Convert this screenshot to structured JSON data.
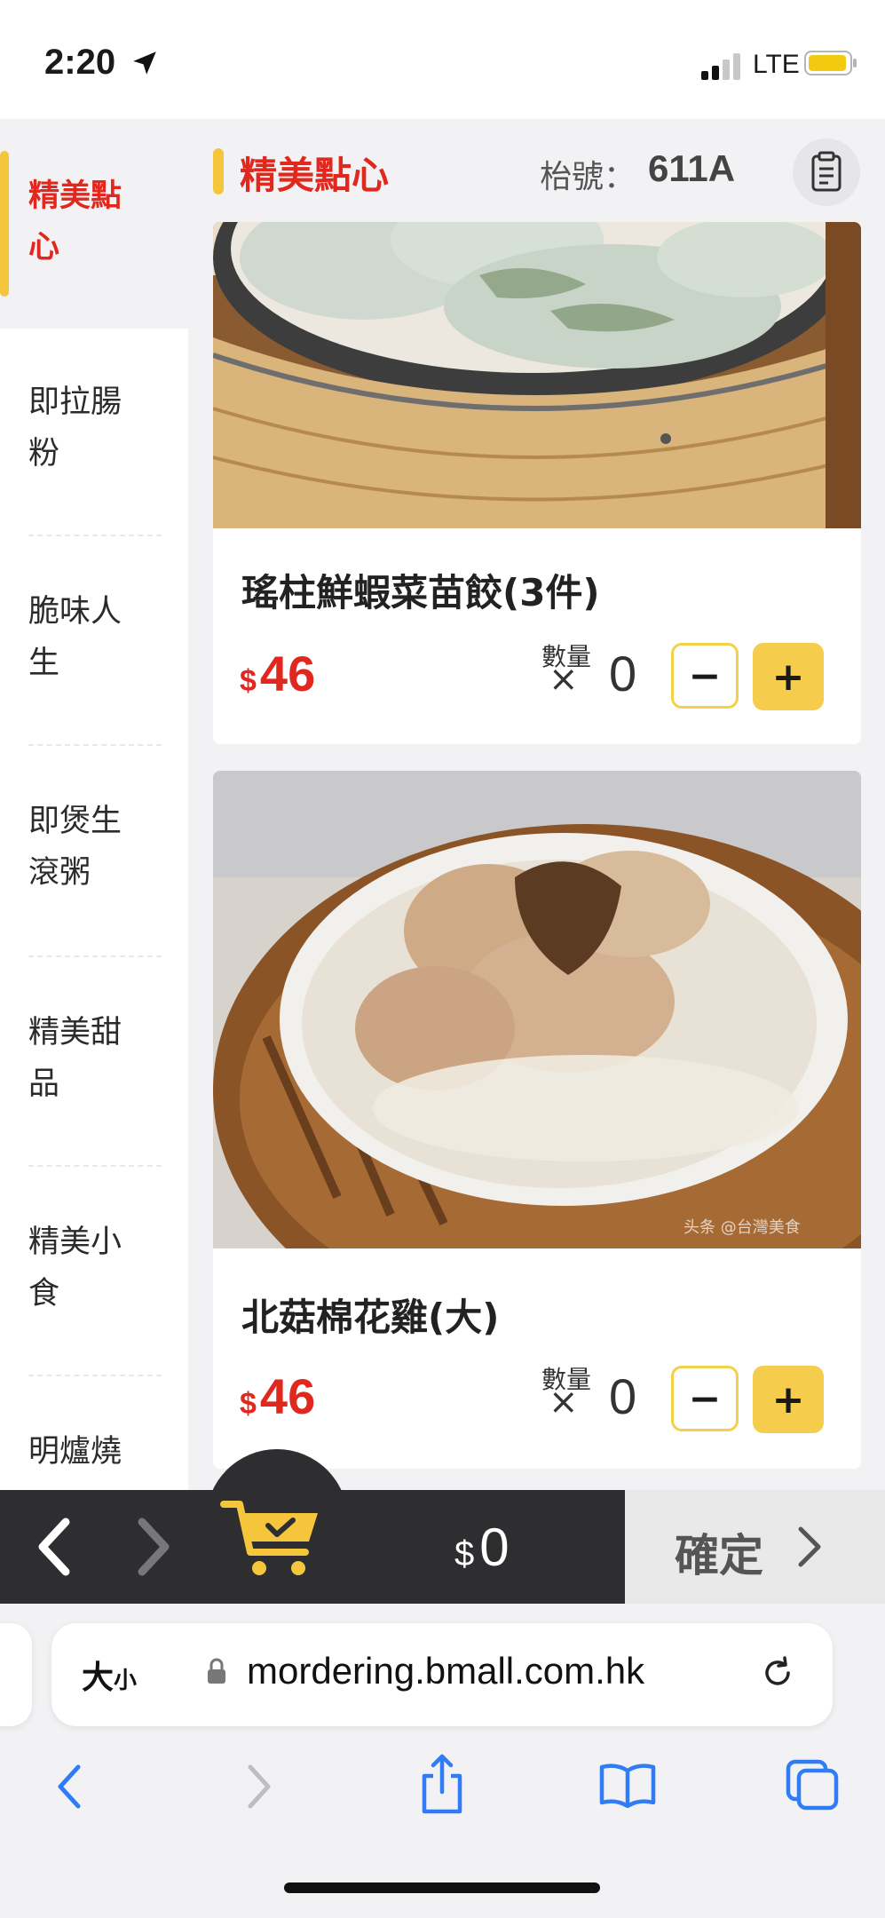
{
  "status_bar": {
    "time": "2:20",
    "network": "LTE"
  },
  "sidebar": {
    "items": [
      {
        "label": "精美點心"
      },
      {
        "label": "即拉腸粉"
      },
      {
        "label": "脆味人生"
      },
      {
        "label": "即煲生滾粥"
      },
      {
        "label": "精美甜品"
      },
      {
        "label": "精美小食"
      },
      {
        "label": "明爐燒"
      }
    ]
  },
  "header": {
    "title": "精美點心",
    "table_label": "枱號：",
    "table_number": "611A"
  },
  "products": [
    {
      "name": "瑤柱鮮蝦菜苗餃(3件)",
      "currency": "$",
      "price": "46",
      "qty_label": "數量",
      "qty_x": "×",
      "qty": "0",
      "minus": "−",
      "plus": "+"
    },
    {
      "name": "北菇棉花雞(大)",
      "currency": "$",
      "price": "46",
      "qty_label": "數量",
      "qty_x": "×",
      "qty": "0",
      "minus": "−",
      "plus": "+"
    }
  ],
  "cart": {
    "currency": "$",
    "total": "0",
    "confirm_label": "確定"
  },
  "browser": {
    "text_size_label": "大",
    "text_size_small": "小",
    "url": "mordering.bmall.com.hk"
  },
  "icons": {
    "location": "location-arrow-icon",
    "order_list": "clipboard-icon",
    "cart": "shopping-cart-icon",
    "back": "chevron-left-icon",
    "forward": "chevron-right-icon",
    "share": "share-icon",
    "bookmarks": "book-icon",
    "tabs": "tabs-icon"
  },
  "colors": {
    "accent": "#f5c63c",
    "price_red": "#e0281e",
    "cart_bar": "#2e2e30",
    "ios_blue": "#2f7cf6"
  }
}
